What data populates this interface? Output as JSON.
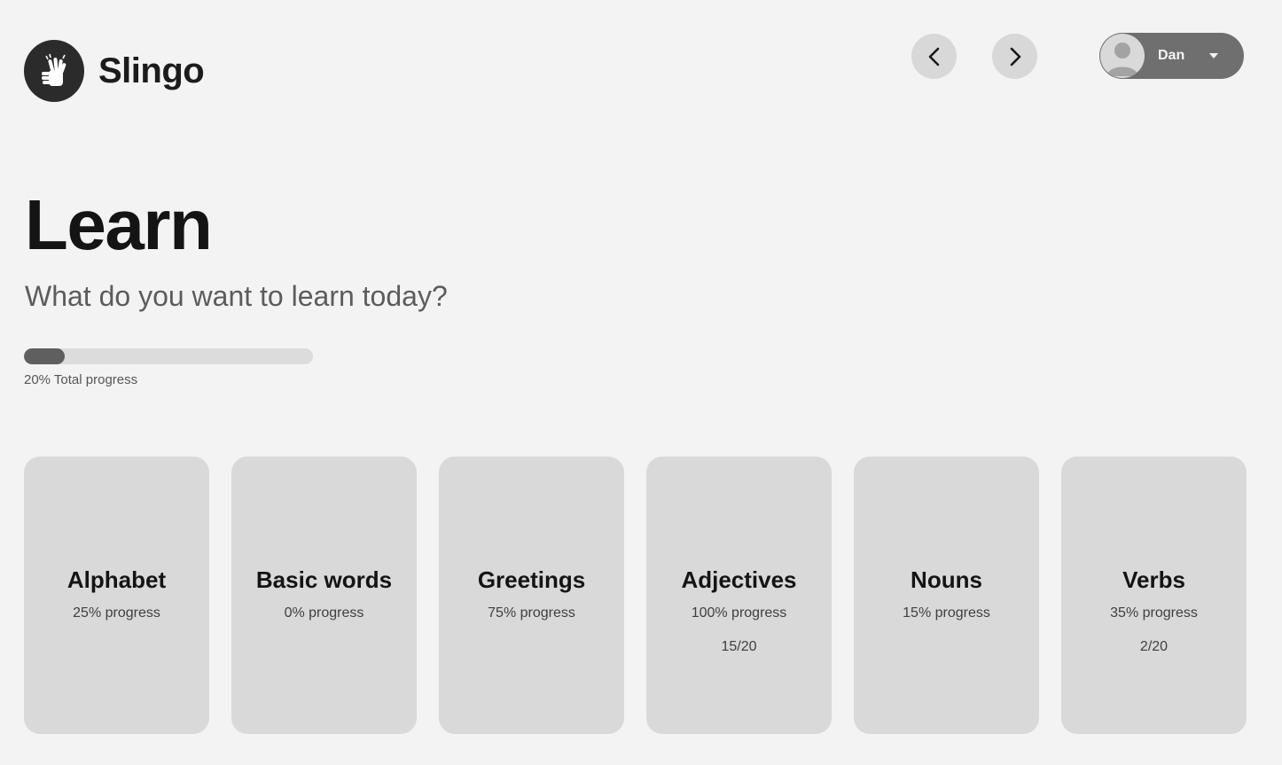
{
  "brand": {
    "name": "Slingo",
    "icon": "hand-sign-icon"
  },
  "nav": {
    "prev_icon": "chevron-left-icon",
    "next_icon": "chevron-right-icon"
  },
  "user": {
    "name": "Dan",
    "avatar_icon": "user-avatar-icon",
    "caret_icon": "caret-down-icon"
  },
  "hero": {
    "title": "Learn",
    "subtitle": "What do you want to learn today?"
  },
  "total_progress": {
    "percent": 20,
    "label": "20% Total progress"
  },
  "categories": [
    {
      "title": "Alphabet",
      "progress": "25% progress",
      "count": ""
    },
    {
      "title": "Basic words",
      "progress": "0% progress",
      "count": ""
    },
    {
      "title": "Greetings",
      "progress": "75% progress",
      "count": ""
    },
    {
      "title": "Adjectives",
      "progress": "100% progress",
      "count": "15/20"
    },
    {
      "title": "Nouns",
      "progress": "15% progress",
      "count": ""
    },
    {
      "title": "Verbs",
      "progress": "35% progress",
      "count": "2/20"
    }
  ],
  "colors": {
    "background": "#f3f3f3",
    "card": "#d9d9d9",
    "progress_fill": "#5f5f5f",
    "user_pill": "#6f6f6f",
    "logo_badge": "#2b2b2b"
  }
}
